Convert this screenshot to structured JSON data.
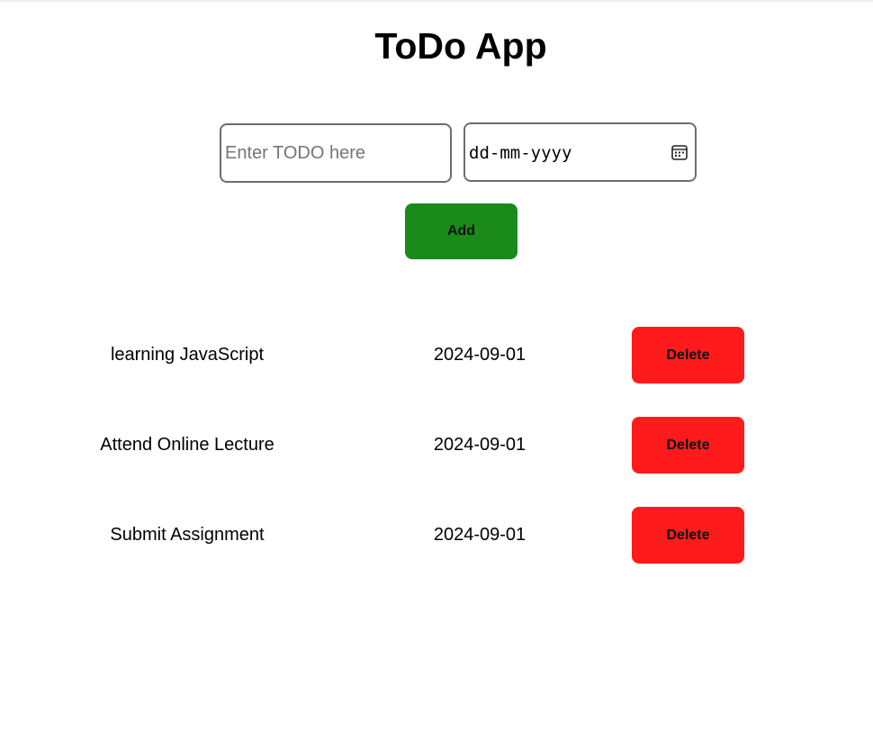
{
  "app": {
    "title": "ToDo App"
  },
  "form": {
    "todo_placeholder": "Enter TODO here",
    "todo_value": "",
    "date_placeholder": "dd-mm-yyyy",
    "date_icon": "calendar-icon",
    "add_label": "Add",
    "add_color": "#1a8a1a"
  },
  "todos": [
    {
      "name": "learning JavaScript",
      "date": "2024-09-01",
      "delete_label": "Delete"
    },
    {
      "name": "Attend Online Lecture",
      "date": "2024-09-01",
      "delete_label": "Delete"
    },
    {
      "name": "Submit Assignment",
      "date": "2024-09-01",
      "delete_label": "Delete"
    }
  ],
  "colors": {
    "delete": "#ff1b1b"
  }
}
